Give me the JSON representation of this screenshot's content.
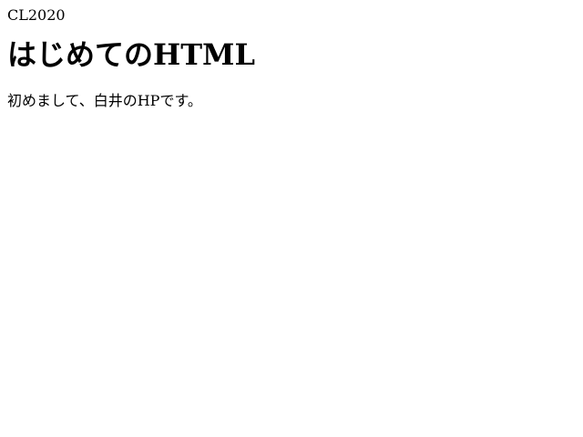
{
  "page": {
    "top_text": "CL2020",
    "title": "はじめてのHTML",
    "intro": "初めまして、白井のHPです。"
  }
}
